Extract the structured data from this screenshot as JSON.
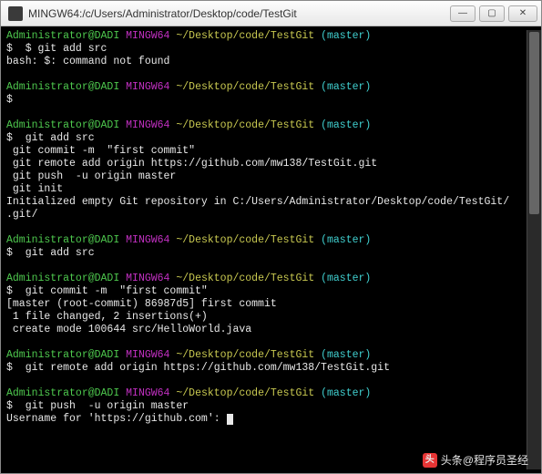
{
  "title": "MINGW64:/c/Users/Administrator/Desktop/code/TestGit",
  "prompt": {
    "user": "Administrator@DADI",
    "env": "MINGW64",
    "path": "~/Desktop/code/TestGit",
    "branch": "(master)"
  },
  "blocks": [
    {
      "cmd": "$ git add src",
      "out": [
        "bash: $: command not found"
      ]
    },
    {
      "cmd": "",
      "out": []
    },
    {
      "cmd": "git add src",
      "out": [
        " git commit -m  \"first commit\"",
        " git remote add origin https://github.com/mw138/TestGit.git",
        " git push  -u origin master",
        " git init",
        "Initialized empty Git repository in C:/Users/Administrator/Desktop/code/TestGit/",
        ".git/"
      ]
    },
    {
      "cmd": "git add src",
      "out": []
    },
    {
      "cmd": "git commit -m  \"first commit\"",
      "out": [
        "[master (root-commit) 86987d5] first commit",
        " 1 file changed, 2 insertions(+)",
        " create mode 100644 src/HelloWorld.java"
      ]
    },
    {
      "cmd": "git remote add origin https://github.com/mw138/TestGit.git",
      "out": []
    },
    {
      "cmd": "git push  -u origin master",
      "out": [
        "Username for 'https://github.com': "
      ],
      "cursor": true
    }
  ],
  "dollar": "$",
  "watermark": {
    "prefix": "头条",
    "name": "@程序员圣经"
  }
}
